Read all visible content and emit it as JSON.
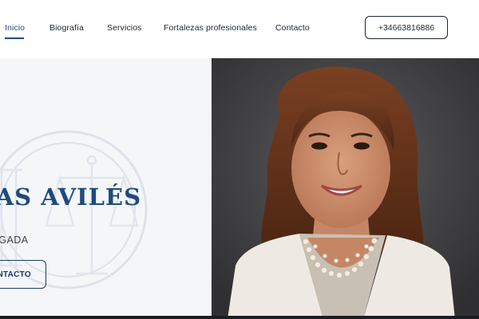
{
  "nav": {
    "links": [
      {
        "label": "Inicio",
        "active": true
      },
      {
        "label": "Biografía"
      },
      {
        "label": "Servicios"
      },
      {
        "label": "Fortalezas profesionales"
      },
      {
        "label": "Contacto"
      }
    ],
    "phone": "+34663816886"
  },
  "hero": {
    "name": "RIAS AVILÉS",
    "role": "OGADA",
    "button_label": "NTACTO",
    "portrait": "portrait-photo"
  },
  "colors": {
    "accent": "#1e4c86",
    "dark": "#1c2433",
    "hero_bg": "#f5f6f8",
    "photo_bg": "#3c3c3e"
  }
}
